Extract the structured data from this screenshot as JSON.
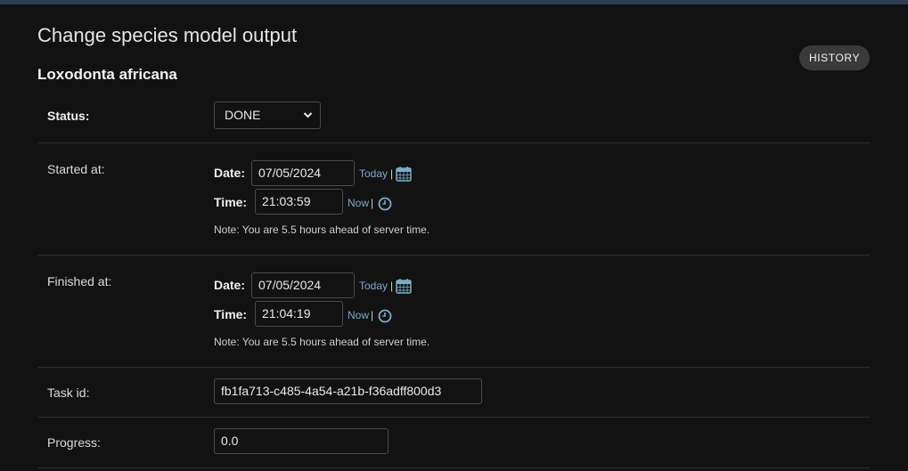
{
  "page": {
    "title": "Change species model output",
    "object_title": "Loxodonta africana",
    "history_label": "HISTORY"
  },
  "form": {
    "status": {
      "label": "Status:",
      "value": "DONE"
    },
    "started_at": {
      "label": "Started at:",
      "date_label": "Date:",
      "date_value": "07/05/2024",
      "today_link": "Today",
      "pipe": "|",
      "time_label": "Time:",
      "time_value": "21:03:59",
      "now_link": "Now",
      "note": "Note: You are 5.5 hours ahead of server time."
    },
    "finished_at": {
      "label": "Finished at:",
      "date_label": "Date:",
      "date_value": "07/05/2024",
      "today_link": "Today",
      "pipe": "|",
      "time_label": "Time:",
      "time_value": "21:04:19",
      "now_link": "Now",
      "note": "Note: You are 5.5 hours ahead of server time."
    },
    "task_id": {
      "label": "Task id:",
      "value": "fb1fa713-c485-4a54-a21b-f36adff800d3"
    },
    "progress": {
      "label": "Progress:",
      "value": "0.0"
    }
  },
  "icons": {
    "calendar": "calendar-icon",
    "clock": "clock-icon",
    "dropdown": "chevron-down-icon"
  },
  "colors": {
    "background": "#121212",
    "link": "#79aec8",
    "header_bar": "#2b3f55",
    "button": "#3a3a3a"
  }
}
